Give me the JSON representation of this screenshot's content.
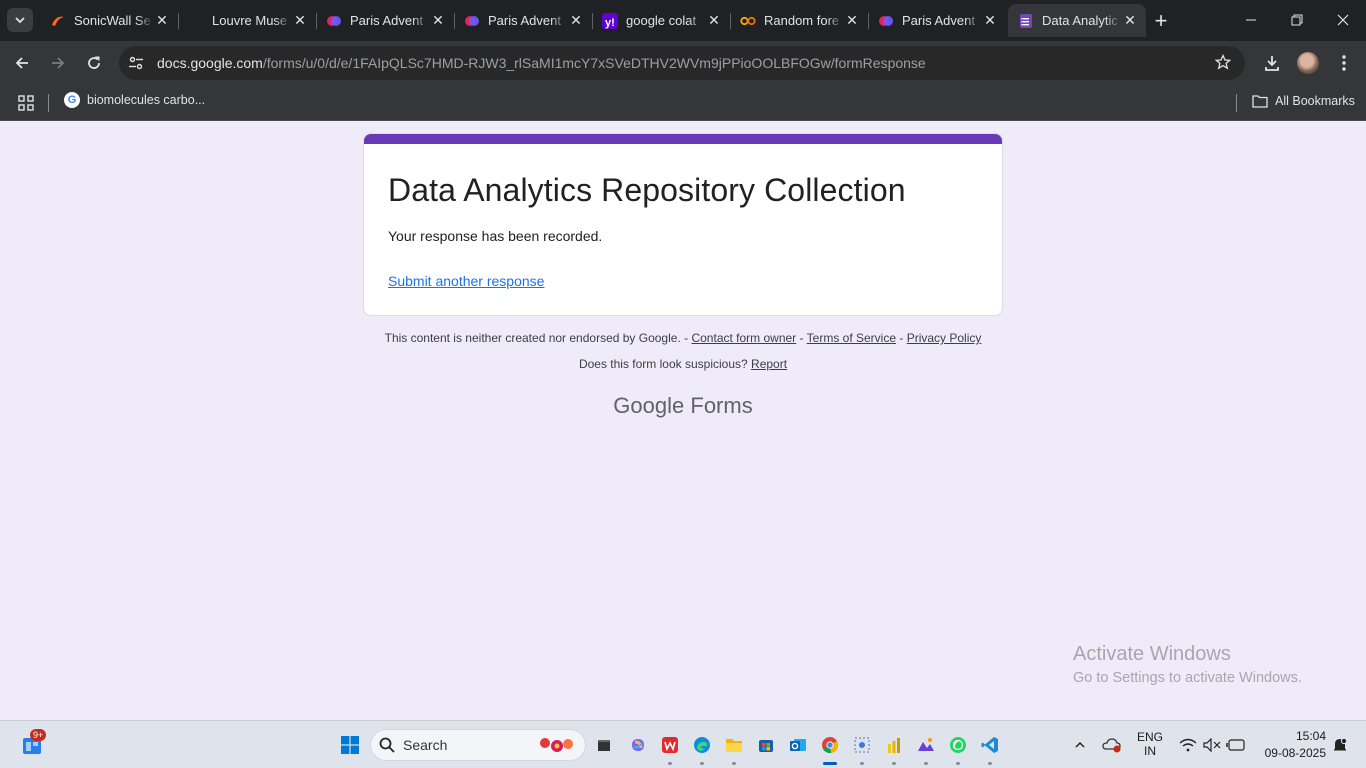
{
  "browser": {
    "tabs": [
      {
        "title": "SonicWall Se",
        "icon": "sonicwall-icon",
        "active": false
      },
      {
        "title": "Louvre Muse",
        "icon": "blank-icon",
        "active": false
      },
      {
        "title": "Paris Advent",
        "icon": "chat-icon",
        "active": false
      },
      {
        "title": "Paris Advent",
        "icon": "chat-icon",
        "active": false
      },
      {
        "title": "google colat",
        "icon": "yahoo-icon",
        "active": false
      },
      {
        "title": "Random fore",
        "icon": "colab-icon",
        "active": false
      },
      {
        "title": "Paris Advent",
        "icon": "chat-icon",
        "active": false
      },
      {
        "title": "Data Analytic",
        "icon": "forms-icon",
        "active": true
      }
    ],
    "url_host": "docs.google.com",
    "url_path": "/forms/u/0/d/e/1FAIpQLSc7HMD-RJW3_rlSaMI1mcY7xSVeDTHV2WVm9jPPioOOLBFOGw/formResponse",
    "bookmarks": [
      {
        "label": "biomolecules carbo...",
        "icon": "google-icon"
      }
    ],
    "all_bookmarks_label": "All Bookmarks"
  },
  "form": {
    "title": "Data Analytics Repository Collection",
    "message": "Your response has been recorded.",
    "link": "Submit another response",
    "accent_color": "#673ab7"
  },
  "footer": {
    "disclaimer": "This content is neither created nor endorsed by Google. -",
    "contact": "Contact form owner",
    "dash1": "-",
    "terms": "Terms of Service",
    "dash2": "-",
    "privacy": "Privacy Policy",
    "suspicious": "Does this form look suspicious?",
    "report": "Report",
    "brand_google": "Google",
    "brand_forms": "Forms"
  },
  "watermark": {
    "line1": "Activate Windows",
    "line2": "Go to Settings to activate Windows."
  },
  "taskbar": {
    "widgets_badge": "9+",
    "search_placeholder": "Search",
    "lang_line1": "ENG",
    "lang_line2": "IN",
    "time": "15:04",
    "date": "09-08-2025"
  }
}
